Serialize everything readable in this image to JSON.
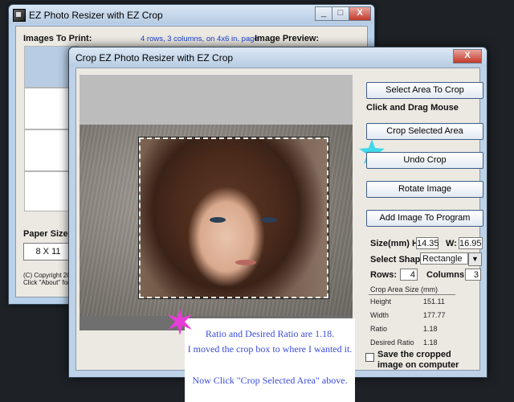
{
  "back_window": {
    "title": "EZ Photo Resizer with EZ Crop",
    "images_to_print_label": "Images To Print:",
    "layout_info": "4 rows, 3 columns, on 4x6 in. page",
    "image_preview_label": "Image Preview:",
    "paper_size_label": "Paper Size:",
    "paper_size_value": "8 X 11",
    "copyright_line1": "(C) Copyright 201",
    "copyright_line2": "Click \"About\" for m"
  },
  "crop_window": {
    "title": "Crop EZ Photo Resizer with EZ Crop",
    "buttons": {
      "select_area": "Select Area To Crop",
      "crop_selected": "Crop Selected Area",
      "undo_crop": "Undo Crop",
      "rotate_image": "Rotate Image",
      "add_image": "Add Image To Program"
    },
    "click_drag_hint": "Click and Drag Mouse",
    "size": {
      "label": "Size(mm) H:",
      "h_value": "14.35",
      "w_label": "W:",
      "w_value": "16.95"
    },
    "shape": {
      "label": "Select Shape:",
      "value": "Rectangle"
    },
    "rows": {
      "label": "Rows:",
      "value": "4"
    },
    "columns": {
      "label": "Columns:",
      "value": "3"
    },
    "crop_area_size": {
      "header": "Crop Area Size (mm)",
      "rows": [
        {
          "label": "Height",
          "value": "151.11"
        },
        {
          "label": "Width",
          "value": "177.77"
        },
        {
          "label": "Ratio",
          "value": "1.18"
        },
        {
          "label": "Desired Ratio",
          "value": "1.18"
        }
      ]
    },
    "save_checkbox_line1": "Save the cropped",
    "save_checkbox_line2": "image on computer",
    "save_checkbox_checked": false
  },
  "annotation": {
    "line1": "Ratio and Desired Ratio are 1.18.",
    "line2": "I moved the crop box to where I wanted it.",
    "line3": "Now Click \"Crop Selected Area\" above.",
    "star_color_pink": "#e83cd6",
    "star_color_cyan": "#3fd9e8"
  },
  "window_buttons": {
    "minimize": "_",
    "maximize": "□",
    "close": "X"
  }
}
